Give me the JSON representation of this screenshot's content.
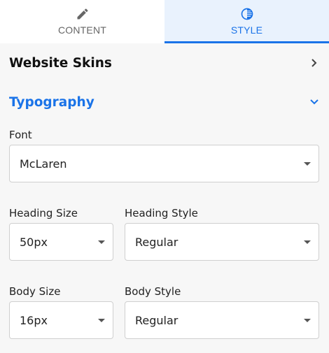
{
  "tabs": [
    {
      "label": "CONTENT",
      "icon": "pencil-icon",
      "active": false
    },
    {
      "label": "STYLE",
      "icon": "contrast-icon",
      "active": true
    }
  ],
  "colors": {
    "accent": "#1a73e8",
    "panel_bg": "#f7f7f7",
    "active_tab_bg": "#e9f2fd"
  },
  "sections": {
    "website_skins": {
      "title": "Website Skins",
      "icon": "chevron-right-icon"
    },
    "typography": {
      "title": "Typography",
      "icon": "chevron-down-icon",
      "expanded": true
    }
  },
  "typography": {
    "font": {
      "label": "Font",
      "value": "McLaren"
    },
    "heading_size": {
      "label": "Heading Size",
      "value": "50px"
    },
    "heading_style": {
      "label": "Heading Style",
      "value": "Regular"
    },
    "body_size": {
      "label": "Body Size",
      "value": "16px"
    },
    "body_style": {
      "label": "Body Style",
      "value": "Regular"
    }
  }
}
